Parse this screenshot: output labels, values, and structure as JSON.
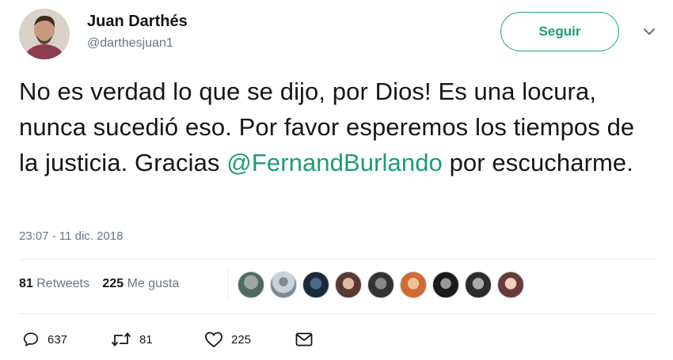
{
  "user": {
    "name": "Juan Darthés",
    "handle": "@darthesjuan1"
  },
  "follow_button": {
    "label": "Seguir"
  },
  "tweet": {
    "text_before_mention": "No es verdad lo que se dijo, por Dios! Es una locura, nunca sucedió eso. Por favor esperemos los tiempos de la justicia. Gracias ",
    "mention": "@FernandBurlando",
    "text_after_mention": " por escucharme."
  },
  "timestamp": "23:07 - 11 dic. 2018",
  "stats": {
    "retweets_count": "81",
    "retweets_label": "Retweets",
    "likes_count": "225",
    "likes_label": "Me gusta"
  },
  "likers_count_shown": 9,
  "actions": {
    "reply_count": "637",
    "retweet_count": "81",
    "like_count": "225"
  },
  "colors": {
    "accent": "#1d9e6e",
    "text": "#14171a",
    "muted": "#657786",
    "divider": "#e6ecf0"
  },
  "icons": [
    "chevron-down-icon",
    "reply-icon",
    "retweet-icon",
    "heart-icon",
    "message-icon"
  ]
}
